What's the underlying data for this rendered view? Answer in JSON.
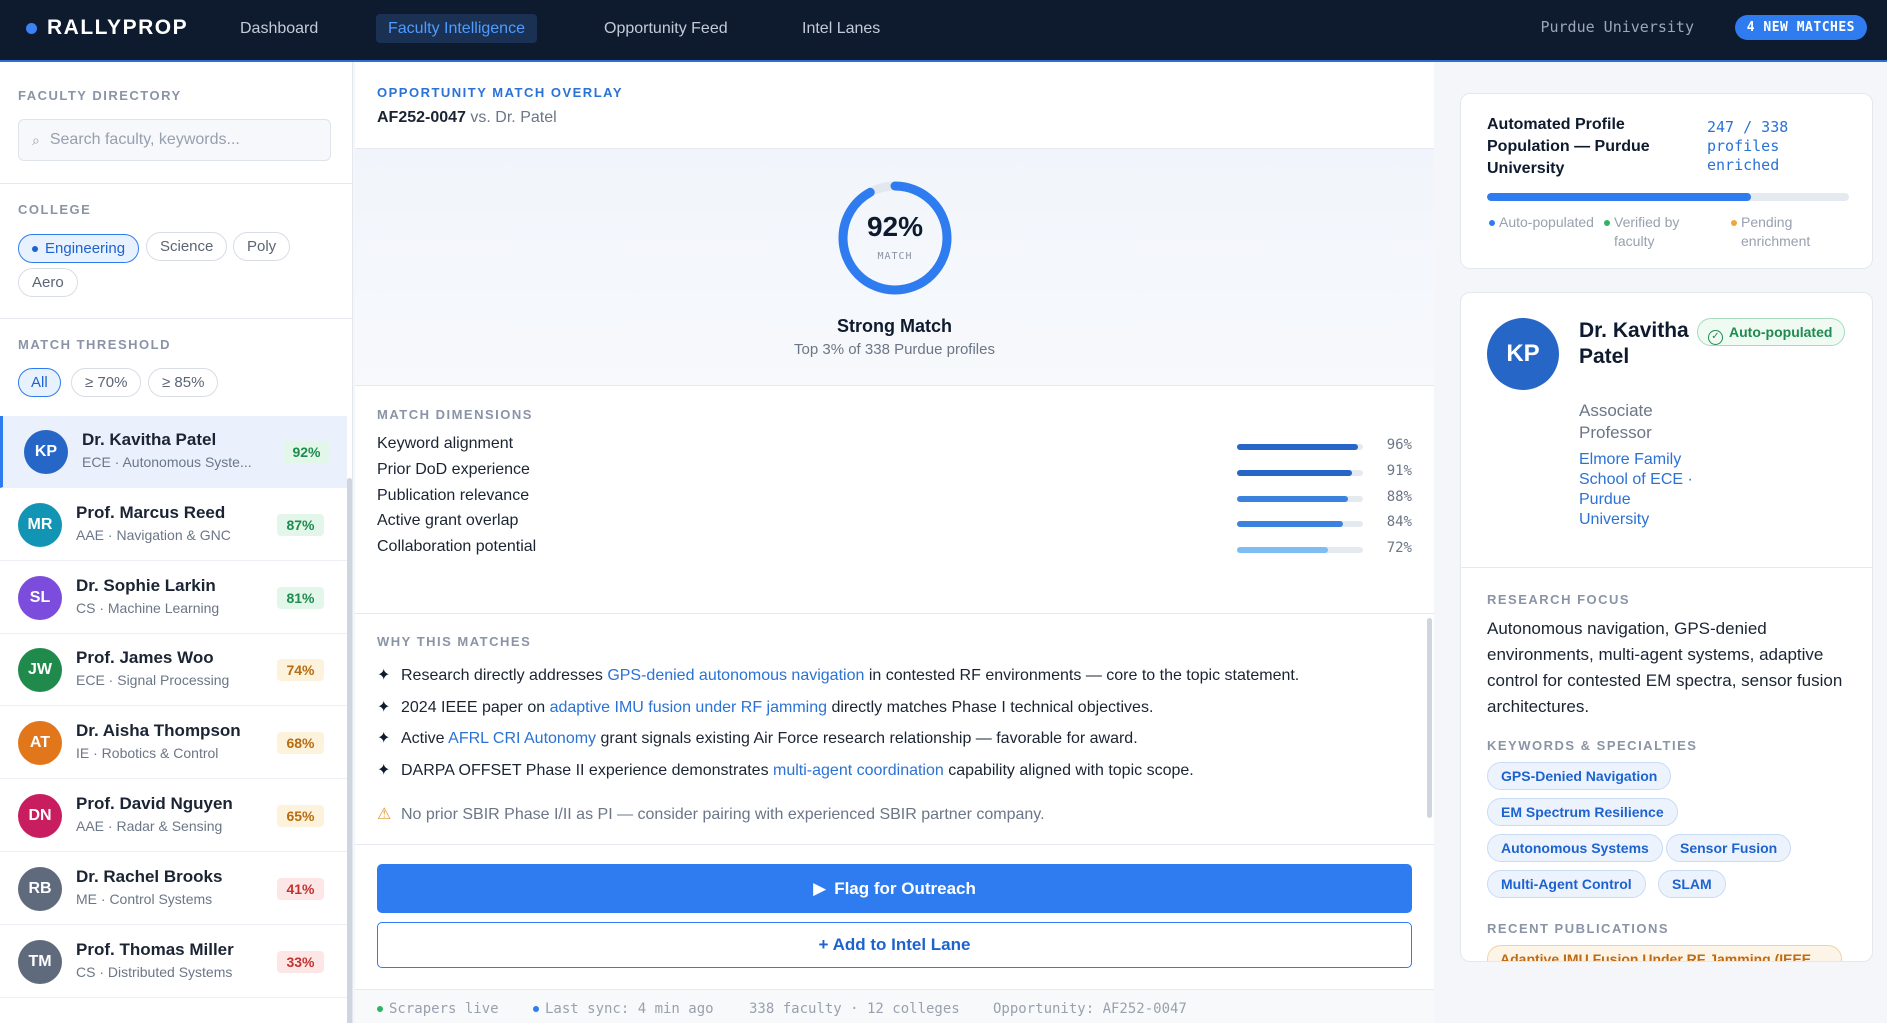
{
  "topbar": {
    "brand": "RALLYPROP",
    "nav": [
      "Dashboard",
      "Faculty Intelligence",
      "Opportunity Feed",
      "Intel Lanes"
    ],
    "active_nav": "Faculty Intelligence",
    "university": "Purdue University",
    "new_matches": "4 NEW MATCHES"
  },
  "sidebar": {
    "directory_title": "FACULTY DIRECTORY",
    "search_placeholder": "Search faculty, keywords...",
    "college_title": "COLLEGE",
    "colleges": [
      "Engineering",
      "Science",
      "Poly",
      "Aero"
    ],
    "selected_college": "Engineering",
    "threshold_title": "MATCH THRESHOLD",
    "thresholds": [
      "All",
      "≥ 70%",
      "≥ 85%"
    ],
    "selected_threshold": "All",
    "faculty": [
      {
        "initials": "KP",
        "name": "Dr. Kavitha Patel",
        "dept": "ECE · Autonomous Syste...",
        "score": "92%",
        "avatar_color": "#2566c7",
        "tier": "high",
        "selected": true
      },
      {
        "initials": "MR",
        "name": "Prof. Marcus Reed",
        "dept": "AAE · Navigation & GNC",
        "score": "87%",
        "avatar_color": "#1294b4",
        "tier": "high"
      },
      {
        "initials": "SL",
        "name": "Dr. Sophie Larkin",
        "dept": "CS · Machine Learning",
        "score": "81%",
        "avatar_color": "#7c4ddc",
        "tier": "high"
      },
      {
        "initials": "JW",
        "name": "Prof. James Woo",
        "dept": "ECE · Signal Processing",
        "score": "74%",
        "avatar_color": "#1f8a4c",
        "tier": "mid"
      },
      {
        "initials": "AT",
        "name": "Dr. Aisha Thompson",
        "dept": "IE · Robotics & Control",
        "score": "68%",
        "avatar_color": "#e2761b",
        "tier": "mid"
      },
      {
        "initials": "DN",
        "name": "Prof. David Nguyen",
        "dept": "AAE · Radar & Sensing",
        "score": "65%",
        "avatar_color": "#c81d5e",
        "tier": "mid"
      },
      {
        "initials": "RB",
        "name": "Dr. Rachel Brooks",
        "dept": "ME · Control Systems",
        "score": "41%",
        "avatar_color": "#5f6b7c",
        "tier": "low"
      },
      {
        "initials": "TM",
        "name": "Prof. Thomas Miller",
        "dept": "CS · Distributed Systems",
        "score": "33%",
        "avatar_color": "#5f6b7c",
        "tier": "low"
      }
    ]
  },
  "overlay": {
    "title": "OPPORTUNITY MATCH OVERLAY",
    "opportunity_id": "AF252-0047",
    "vs_text": "vs. Dr. Patel",
    "match_pct": "92%",
    "match_value": 0.92,
    "match_label": "MATCH",
    "verdict": "Strong Match",
    "verdict_sub": "Top 3% of 338 Purdue profiles",
    "dimensions_title": "MATCH DIMENSIONS",
    "dimensions": [
      {
        "label": "Keyword alignment",
        "value": 96,
        "display": "96%"
      },
      {
        "label": "Prior DoD experience",
        "value": 91,
        "display": "91%"
      },
      {
        "label": "Publication relevance",
        "value": 88,
        "display": "88%"
      },
      {
        "label": "Active grant overlap",
        "value": 84,
        "display": "84%"
      },
      {
        "label": "Collaboration potential",
        "value": 72,
        "display": "72%"
      }
    ],
    "why_title": "WHY THIS MATCHES",
    "reasons": [
      {
        "pre": "Research directly addresses ",
        "hl": "GPS-denied autonomous navigation",
        "post": " in contested RF environments — core to the topic statement."
      },
      {
        "pre": "2024 IEEE paper on ",
        "hl": "adaptive IMU fusion under RF jamming",
        "post": " directly matches Phase I technical objectives."
      },
      {
        "pre": "Active ",
        "hl": "AFRL CRI Autonomy",
        "post": " grant signals existing Air Force research relationship — favorable for award."
      },
      {
        "pre": "DARPA OFFSET Phase II experience demonstrates ",
        "hl": "multi-agent coordination",
        "post": " capability aligned with topic scope."
      }
    ],
    "warning": "No prior SBIR Phase I/II as PI — consider pairing with experienced SBIR partner company.",
    "flag_button": "Flag for Outreach",
    "add_button": "+ Add to Intel Lane"
  },
  "status_bar": {
    "scrapers": "Scrapers live",
    "sync": "Last sync: 4 min ago",
    "counts": "338 faculty · 12 colleges",
    "opportunity": "Opportunity: AF252-0047"
  },
  "automation": {
    "title": "Automated Profile Population — Purdue University",
    "count": "247 / 338 profiles enriched",
    "progress": 0.73,
    "legend": [
      {
        "label": "Auto-populated",
        "color": "#2f7cf0"
      },
      {
        "label": "Verified by faculty",
        "color": "#2fb464"
      },
      {
        "label": "Pending enrichment",
        "color": "#f0a43a"
      }
    ]
  },
  "profile": {
    "initials": "KP",
    "name": "Dr. Kavitha Patel",
    "title": "Associate Professor",
    "dept": "Elmore Family School of ECE · Purdue University",
    "badge": "Auto-populated",
    "focus_title": "RESEARCH FOCUS",
    "focus": "Autonomous navigation, GPS-denied environments, multi-agent systems, adaptive control for contested EM spectra, sensor fusion architectures.",
    "keywords_title": "KEYWORDS & SPECIALTIES",
    "keywords": [
      "GPS-Denied Navigation",
      "EM Spectrum Resilience",
      "Autonomous Systems",
      "Sensor Fusion",
      "Multi-Agent Control",
      "SLAM"
    ],
    "pubs_title": "RECENT PUBLICATIONS",
    "publication": "Adaptive IMU Fusion Under RF Jamming (IEEE"
  },
  "colors": {
    "accent": "#2f7cf0",
    "navy": "#0e1a2e",
    "success": "#1e8c4e",
    "warning": "#e09b2d"
  }
}
